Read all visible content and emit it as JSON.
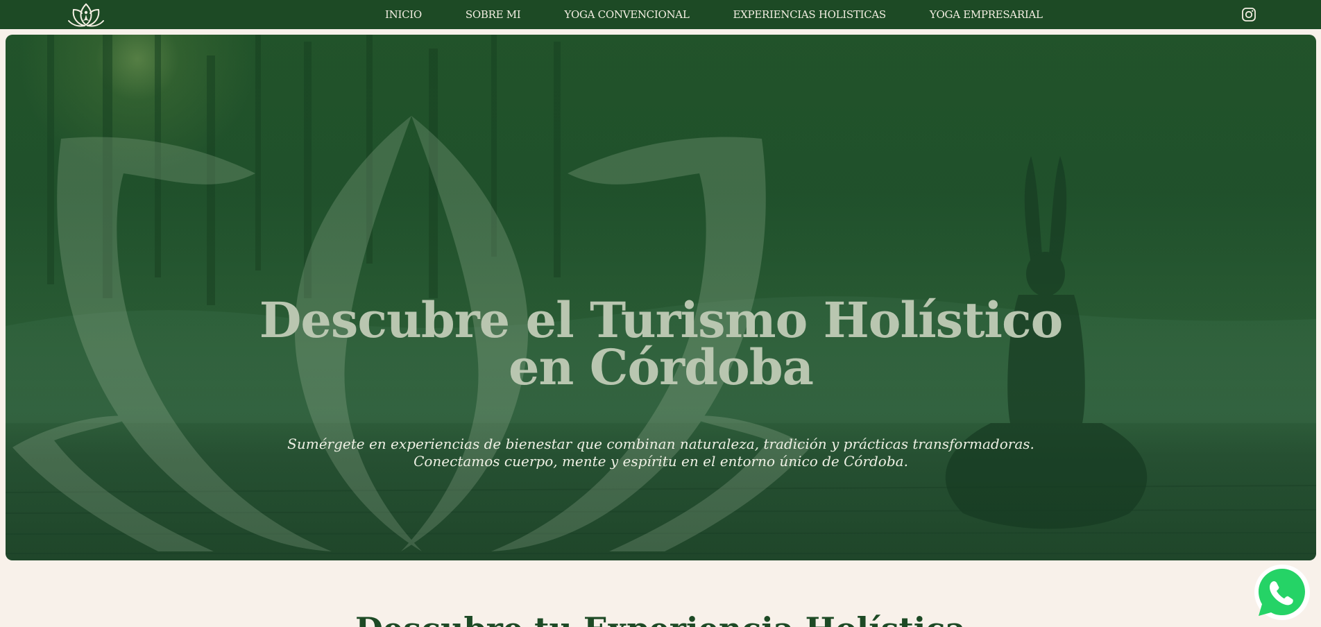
{
  "nav": {
    "logo_icon": "lotus-meditation-logo",
    "links": [
      {
        "label": "INICIO"
      },
      {
        "label": "SOBRE MI"
      },
      {
        "label": "YOGA CONVENCIONAL"
      },
      {
        "label": "EXPERIENCIAS HOLISTICAS"
      },
      {
        "label": "YOGA EMPRESARIAL"
      }
    ],
    "social_icon": "instagram-icon"
  },
  "hero": {
    "title_line1": "Descubre el Turismo Holístico",
    "title_line2": "en Córdoba",
    "subtitle_line1": "Sumérgete en experiencias de bienestar que combinan naturaleza, tradición y prácticas transformadoras.",
    "subtitle_line2": "Conectamos cuerpo, mente y espíritu en el entorno único de Córdoba."
  },
  "next_section": {
    "heading": "Descubre tu Experiencia Holística"
  },
  "floating": {
    "whatsapp_icon": "whatsapp-icon"
  },
  "colors": {
    "nav_bg": "#1d4a25",
    "page_bg": "#f8f1ea",
    "accent_green": "#25d366"
  }
}
